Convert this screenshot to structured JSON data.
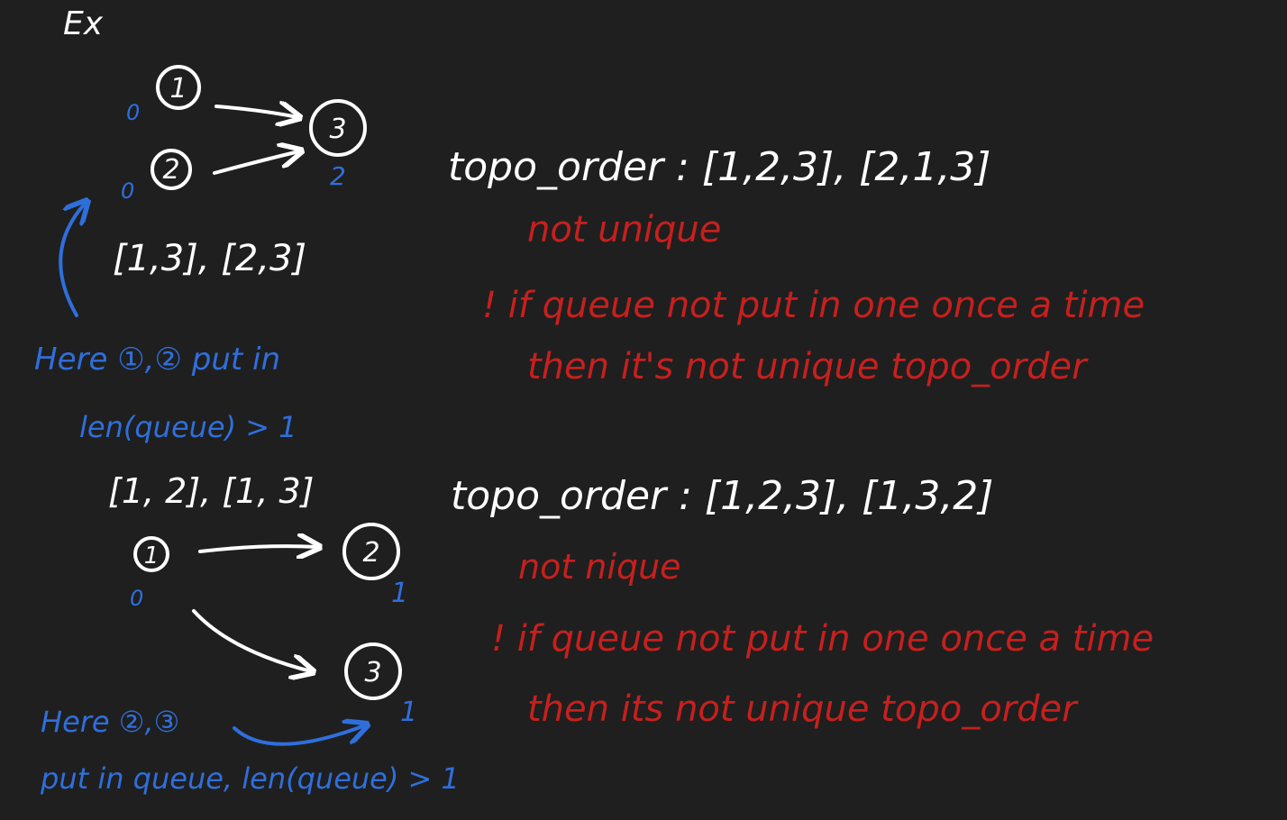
{
  "colors": {
    "background": "#1f1f1f",
    "white_ink": "#ffffff",
    "blue_ink": "#2f6fdc",
    "red_ink": "#c6201e"
  },
  "heading": "Ex",
  "example1": {
    "nodes": [
      "1",
      "2",
      "3"
    ],
    "indegrees": {
      "node1": "0",
      "node2": "0",
      "node3": "2"
    },
    "edge_lists": "[1,3], [2,3]",
    "blue_note_line1": "Here ①,② put in",
    "blue_note_line2": "len(queue) > 1",
    "topo_order": "topo_order : [1,2,3], [2,1,3]",
    "verdict": "not unique",
    "rule_line1": "! if queue not put in one once a time",
    "rule_line2": "then it's not unique topo_order"
  },
  "example2": {
    "edge_lists": "[1, 2], [1, 3]",
    "nodes": [
      "1",
      "2",
      "3"
    ],
    "indegrees": {
      "node1": "0",
      "node2": "1",
      "node3": "1"
    },
    "blue_note_line1": "Here ②,③",
    "blue_note_line2": "put in queue, len(queue) > 1",
    "topo_order": "topo_order : [1,2,3], [1,3,2]",
    "verdict": "not nique",
    "rule_line1": "! if queue not put in one once a time",
    "rule_line2": "then its not unique topo_order"
  }
}
